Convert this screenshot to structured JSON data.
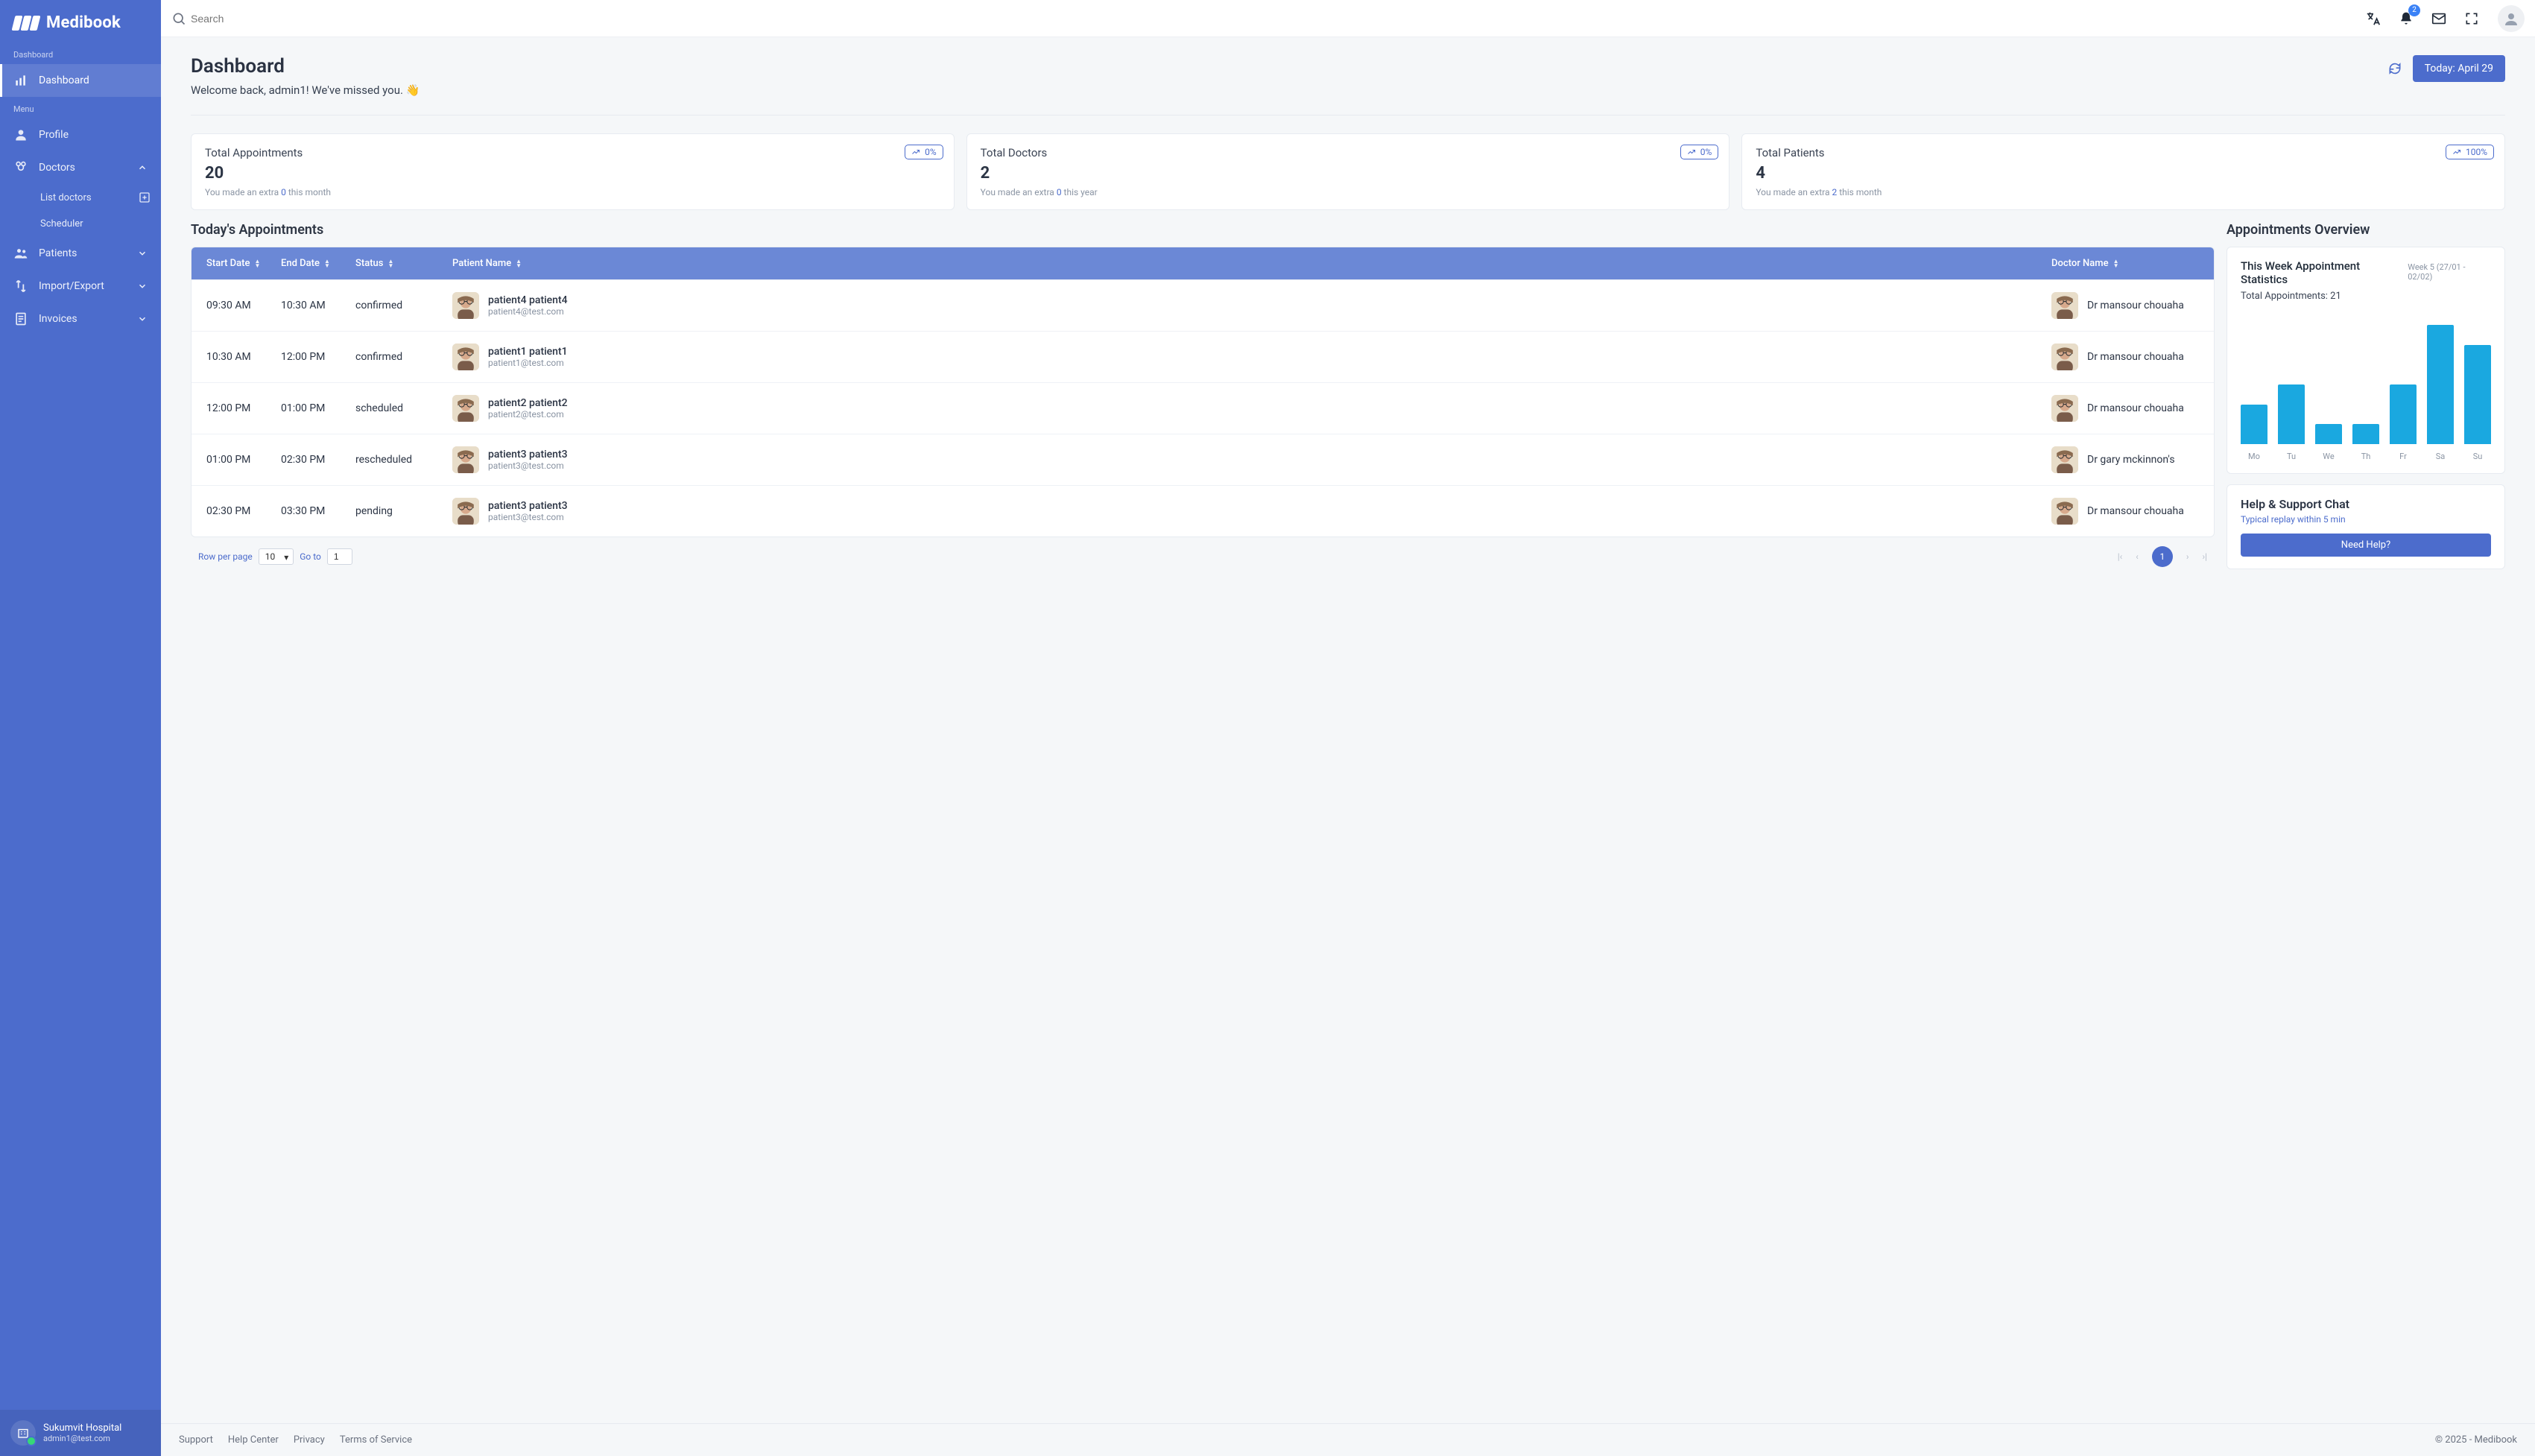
{
  "brand": "Medibook",
  "sidebar": {
    "section1_label": "Dashboard",
    "section2_label": "Menu",
    "dashboard": "Dashboard",
    "profile": "Profile",
    "doctors": "Doctors",
    "doctors_sub_list": "List doctors",
    "doctors_sub_scheduler": "Scheduler",
    "patients": "Patients",
    "import_export": "Import/Export",
    "invoices": "Invoices"
  },
  "sidebar_footer": {
    "name": "Sukumvit Hospital",
    "email": "admin1@test.com"
  },
  "topbar": {
    "search_placeholder": "Search",
    "notif_count": "2"
  },
  "page": {
    "title": "Dashboard",
    "welcome": "Welcome back, admin1! We've missed you. 👋",
    "today_btn": "Today: April 29"
  },
  "stats": [
    {
      "title": "Total Appointments",
      "value": "20",
      "pct": "0%",
      "note_pre": "You made an extra ",
      "note_hl": "0",
      "note_post": " this month"
    },
    {
      "title": "Total Doctors",
      "value": "2",
      "pct": "0%",
      "note_pre": "You made an extra ",
      "note_hl": "0",
      "note_post": " this year"
    },
    {
      "title": "Total Patients",
      "value": "4",
      "pct": "100%",
      "note_pre": "You made an extra ",
      "note_hl": "2",
      "note_post": " this month"
    }
  ],
  "appointments": {
    "title": "Today's Appointments",
    "columns": {
      "start": "Start Date",
      "end": "End Date",
      "status": "Status",
      "patient": "Patient Name",
      "doctor": "Doctor Name"
    },
    "rows": [
      {
        "start": "09:30 AM",
        "end": "10:30 AM",
        "status": "confirmed",
        "patient_name": "patient4 patient4",
        "patient_email": "patient4@test.com",
        "doctor": "Dr mansour chouaha"
      },
      {
        "start": "10:30 AM",
        "end": "12:00 PM",
        "status": "confirmed",
        "patient_name": "patient1 patient1",
        "patient_email": "patient1@test.com",
        "doctor": "Dr mansour chouaha"
      },
      {
        "start": "12:00 PM",
        "end": "01:00 PM",
        "status": "scheduled",
        "patient_name": "patient2 patient2",
        "patient_email": "patient2@test.com",
        "doctor": "Dr mansour chouaha"
      },
      {
        "start": "01:00 PM",
        "end": "02:30 PM",
        "status": "rescheduled",
        "patient_name": "patient3 patient3",
        "patient_email": "patient3@test.com",
        "doctor": "Dr gary mckinnon's"
      },
      {
        "start": "02:30 PM",
        "end": "03:30 PM",
        "status": "pending",
        "patient_name": "patient3 patient3",
        "patient_email": "patient3@test.com",
        "doctor": "Dr mansour chouaha"
      }
    ],
    "pager": {
      "rpp_label": "Row per page",
      "rpp_value": "10",
      "goto_label": "Go to",
      "goto_value": "1",
      "current_page": "1"
    }
  },
  "overview": {
    "title": "Appointments Overview",
    "card_title": "This Week Appointment Statistics",
    "week_label": "Week 5 (27/01 - 02/02)",
    "total_label": "Total Appointments: 21",
    "help_title": "Help & Support Chat",
    "help_sub": "Typical replay within 5 min",
    "help_btn": "Need Help?"
  },
  "chart_data": {
    "type": "bar",
    "categories": [
      "Mo",
      "Tu",
      "We",
      "Th",
      "Fr",
      "Sa",
      "Su"
    ],
    "values": [
      2,
      3,
      1,
      1,
      3,
      6,
      5
    ],
    "title": "This Week Appointment Statistics",
    "xlabel": "",
    "ylabel": "",
    "ylim": [
      0,
      6
    ],
    "total": 21
  },
  "footer": {
    "support": "Support",
    "help_center": "Help Center",
    "privacy": "Privacy",
    "terms": "Terms of Service",
    "copyright": "© 2025 - Medibook"
  }
}
